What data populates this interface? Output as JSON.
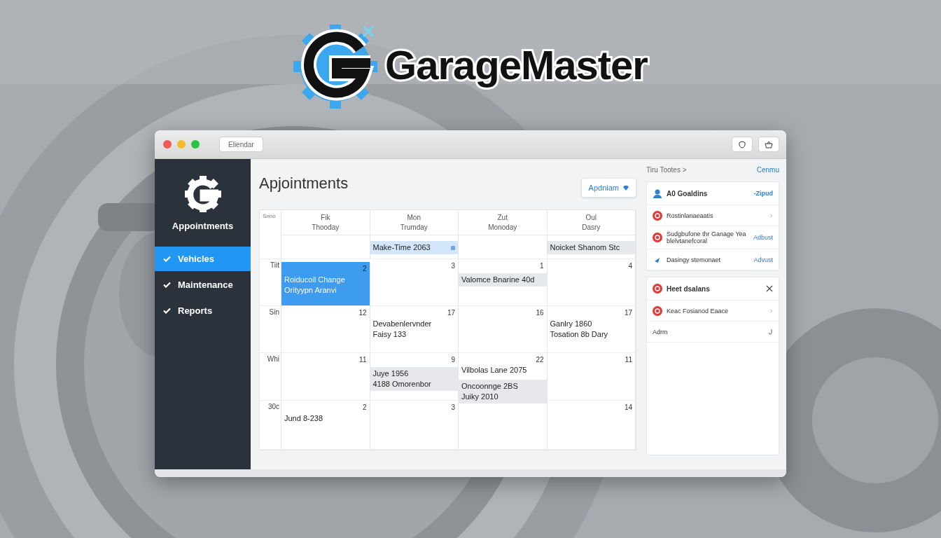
{
  "app_logo": {
    "name": "GarageMaster"
  },
  "window": {
    "toolbar_button": "Eliendar"
  },
  "sidebar": {
    "title": "Appointments",
    "items": [
      {
        "label": "Vehicles",
        "selected": true
      },
      {
        "label": "Maintenance",
        "selected": false
      },
      {
        "label": "Reports",
        "selected": false
      }
    ]
  },
  "main": {
    "title": "Apjointments",
    "action_button": "Apdniam",
    "calendar": {
      "corner": "Snno",
      "columns": [
        {
          "top": "Fik",
          "bottom": "Thooday"
        },
        {
          "top": "Mon",
          "bottom": "Trumday"
        },
        {
          "top": "Zut",
          "bottom": "Monoday"
        },
        {
          "top": "Oul",
          "bottom": "Dasry"
        }
      ],
      "rows": [
        {
          "cells": [
            {
              "selected": false
            },
            {
              "selected": false,
              "events": [
                {
                  "kind": "tag",
                  "lines": [
                    "Make-Time 2063"
                  ]
                }
              ]
            },
            {
              "selected": false
            },
            {
              "selected": false,
              "events": [
                {
                  "kind": "shade",
                  "lines": [
                    "Noicket Shanom Stc"
                  ]
                }
              ]
            }
          ]
        },
        {
          "label": "Tiit",
          "cells": [
            {
              "number": "2",
              "selected": true,
              "events": [
                {
                  "kind": "plain",
                  "lines": [
                    "Roiducoil Change",
                    "Orityypn Aranvi"
                  ]
                }
              ]
            },
            {
              "number": "3",
              "selected": false
            },
            {
              "number": "1",
              "selected": false,
              "events": [
                {
                  "kind": "shade",
                  "lines": [
                    "Valomce Bnarine 40d"
                  ]
                }
              ]
            },
            {
              "number": "4",
              "selected": false
            }
          ]
        },
        {
          "label": "Sin",
          "cells": [
            {
              "number": "12",
              "selected": false
            },
            {
              "number": "17",
              "selected": false,
              "events": [
                {
                  "kind": "plain",
                  "lines": [
                    "Devabenlervnder",
                    "Faisy 133"
                  ]
                }
              ]
            },
            {
              "number": "16",
              "selected": false
            },
            {
              "number": "17",
              "selected": false,
              "events": [
                {
                  "kind": "plain",
                  "lines": [
                    "Ganlry 1860",
                    "Tosation 8b Dary"
                  ]
                }
              ]
            }
          ]
        },
        {
          "label": "Whi",
          "cells": [
            {
              "number": "11",
              "selected": false
            },
            {
              "number": "9",
              "selected": false,
              "events": [
                {
                  "kind": "shade",
                  "lines": [
                    "Juye 1956",
                    "4188 Omorenbor"
                  ]
                }
              ]
            },
            {
              "number": "22",
              "selected": false,
              "events": [
                {
                  "kind": "plain",
                  "lines": [
                    "Vilbolas Lane 2075"
                  ]
                },
                {
                  "kind": "shade",
                  "lines": [
                    "Oncoonnge 2BS",
                    "Juiky 2010"
                  ]
                }
              ]
            },
            {
              "number": "11",
              "selected": false
            }
          ]
        },
        {
          "label": "30c",
          "cells": [
            {
              "number": "2",
              "selected": false,
              "events": [
                {
                  "kind": "plain",
                  "lines": [
                    "Jund 8-238"
                  ]
                }
              ]
            },
            {
              "number": "3",
              "selected": false
            },
            {
              "selected": false
            },
            {
              "number": "14",
              "selected": false
            }
          ]
        }
      ]
    }
  },
  "panel": {
    "title": "Tiru Tootes >",
    "link": "Cenmu",
    "cards": [
      {
        "items": [
          {
            "kind": "user-header",
            "text": "A0 Goaldins",
            "action": "-Zipud"
          },
          {
            "kind": "alert-row",
            "text": "Rostinlanaeaatis"
          },
          {
            "kind": "alert-row",
            "text": "Sudgbufone thr Ganage Yea blelvtanefcoral",
            "action": "Adbust"
          },
          {
            "kind": "pin-row",
            "text": "Dasingy stemonaet",
            "action": "Advust"
          }
        ]
      },
      {
        "items": [
          {
            "kind": "alert-header",
            "text": "Heet dsalans"
          },
          {
            "kind": "alert-row",
            "text": "Keac Fosianod Eaace"
          },
          {
            "kind": "plain-row",
            "text": "Adrm"
          }
        ]
      }
    ]
  }
}
